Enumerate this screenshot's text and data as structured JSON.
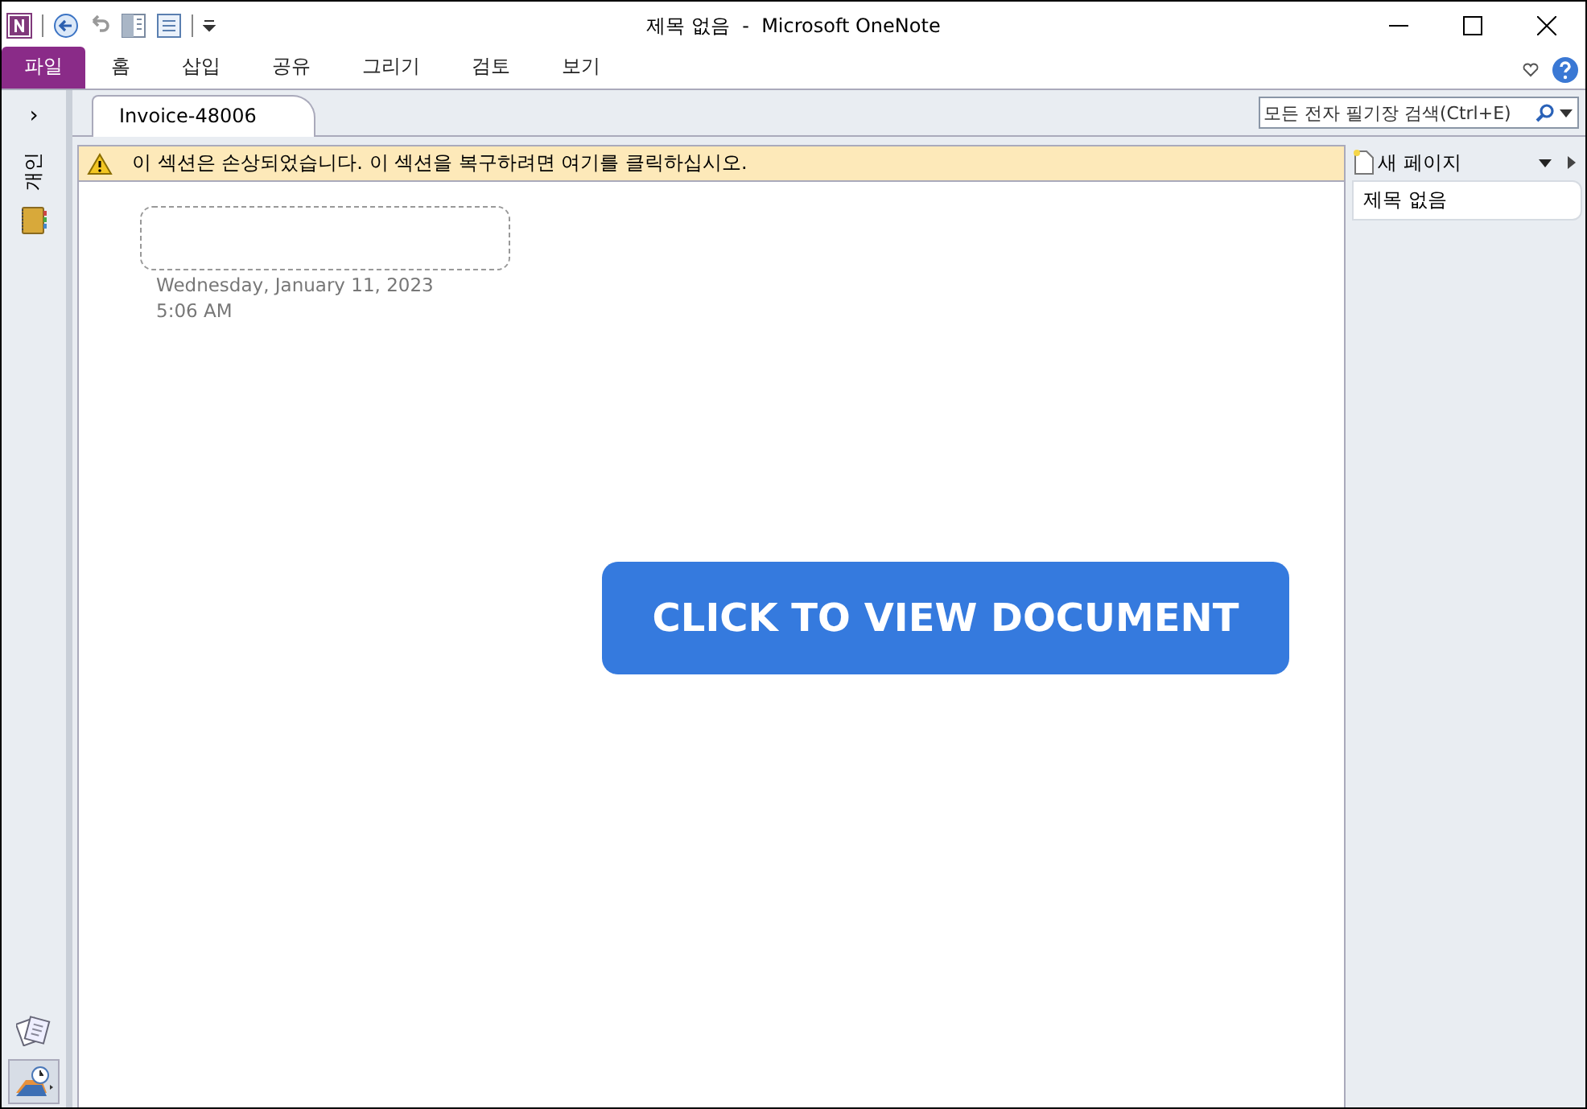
{
  "window": {
    "title": "제목 없음  -  Microsoft OneNote"
  },
  "ribbon_tabs": [
    {
      "label": "파일",
      "selected": true
    },
    {
      "label": "홈",
      "selected": false
    },
    {
      "label": "삽입",
      "selected": false
    },
    {
      "label": "공유",
      "selected": false
    },
    {
      "label": "그리기",
      "selected": false
    },
    {
      "label": "검토",
      "selected": false
    },
    {
      "label": "보기",
      "selected": false
    }
  ],
  "nav_toggle": "›",
  "notebook": {
    "name": "개인"
  },
  "section_tabs": [
    {
      "label": "Invoice-48006",
      "selected": true
    }
  ],
  "search": {
    "placeholder": "모든 전자 필기장 검색(Ctrl+E)"
  },
  "warning": {
    "text": "이 섹션은 손상되었습니다. 이 섹션을 복구하려면 여기를 클릭하십시오."
  },
  "page": {
    "date": "Wednesday, January 11, 2023",
    "time": "5:06 AM",
    "overlay_button": "CLICK TO VIEW DOCUMENT"
  },
  "page_list": {
    "new_page": "새 페이지",
    "pages": [
      {
        "title": "제목 없음",
        "selected": true
      }
    ]
  }
}
